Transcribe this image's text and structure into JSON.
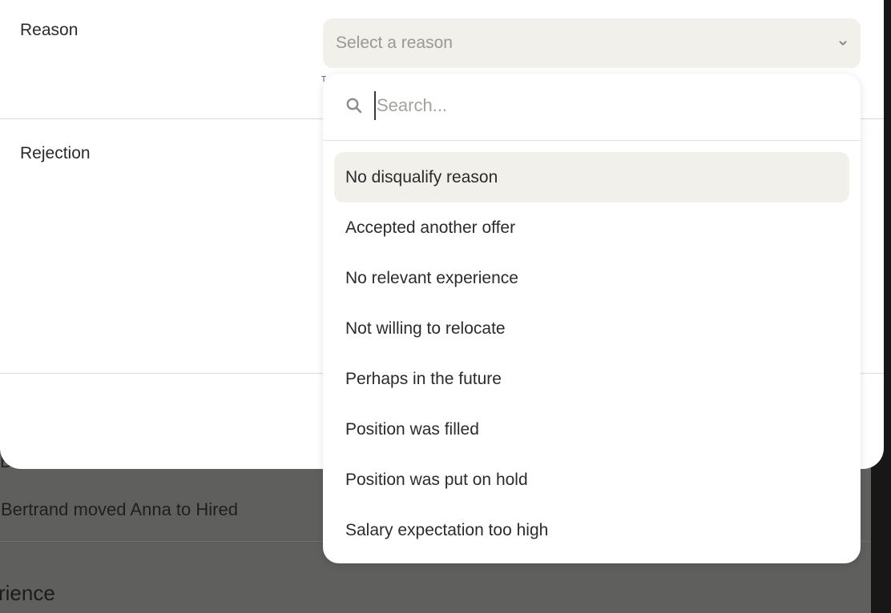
{
  "background": {
    "partial_text": "B",
    "activity_text": "Bertrand moved Anna to Hired",
    "section_heading": "rience"
  },
  "form": {
    "reason_label": "Reason",
    "rejection_label": "Rejection",
    "select_placeholder": "Select a reason",
    "tiny_mark": "T"
  },
  "dropdown": {
    "search_placeholder": "Search...",
    "options": [
      {
        "label": "No disqualify reason",
        "highlighted": true
      },
      {
        "label": "Accepted another offer"
      },
      {
        "label": "No relevant experience"
      },
      {
        "label": "Not willing to relocate"
      },
      {
        "label": "Perhaps in the future"
      },
      {
        "label": "Position was filled"
      },
      {
        "label": "Position was put on hold"
      },
      {
        "label": "Salary expectation too high"
      }
    ]
  },
  "icons": {
    "search": "search-icon",
    "chevron": "chevron-down-icon"
  },
  "colors": {
    "select_bg": "#f1f0ea",
    "highlight_bg": "#f1f0ea",
    "overlay_bg": "#5f5f5e"
  }
}
